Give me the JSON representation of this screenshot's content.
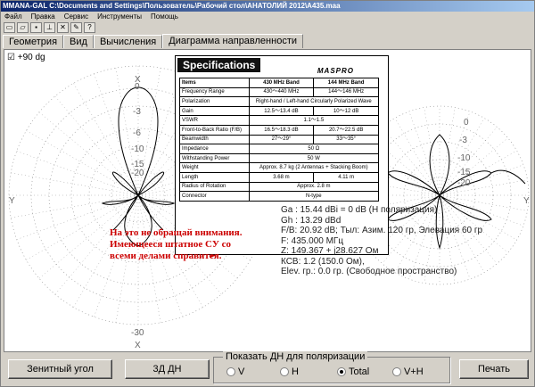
{
  "window": {
    "title": "MMANA-GAL C:\\Documents and Settings\\Пользователь\\Рабочий стол\\АНАТОЛИЙ 2012\\A435.maa"
  },
  "menu": [
    "Файл",
    "Правка",
    "Сервис",
    "Инструменты",
    "Помощь"
  ],
  "toolbar": [
    {
      "icon": "new-file-icon",
      "glyph": "▭"
    },
    {
      "icon": "open-folder-icon",
      "glyph": "▱"
    },
    {
      "icon": "save-icon",
      "glyph": "▪"
    },
    {
      "icon": "antenna-icon",
      "glyph": "⊥"
    },
    {
      "icon": "wrench-icon",
      "glyph": "✕"
    },
    {
      "icon": "pencil-icon",
      "glyph": "✎"
    },
    {
      "icon": "help-icon",
      "glyph": "?"
    }
  ],
  "tabs": [
    "Геометрия",
    "Вид",
    "Вычисления",
    "Диаграмма направленности"
  ],
  "active_tab": 3,
  "plot": {
    "checkbox_label": "+90 dg",
    "rings": [
      "0",
      "-3",
      "-6",
      "-10",
      "-15",
      "-20",
      "-30"
    ],
    "axes": {
      "top": "X",
      "left": "Y",
      "right": "Y",
      "bottom": "X"
    },
    "right_labels": [
      "0",
      "-3",
      "-10",
      "-15",
      "-20"
    ]
  },
  "specs": {
    "title": "Specifications",
    "brand": "MASPRO",
    "columns": [
      "Items",
      "430 MHz Band",
      "144 MHz Band"
    ],
    "rows": [
      [
        "Frequency Range",
        "430～440 MHz",
        "144～146 MHz"
      ],
      [
        "Polarization",
        "Right-hand / Left-hand Circularly Polarized Wave",
        ""
      ],
      [
        "Gain",
        "12.5～13.4 dB",
        "10～12 dB"
      ],
      [
        "VSWR",
        "1.1～1.5",
        ""
      ],
      [
        "Front-to-Back Ratio (F/B)",
        "16.5～18.3 dB",
        "20.7～22.5 dB"
      ],
      [
        "Beamwidth",
        "27～29°",
        "33～35°"
      ],
      [
        "Impedance",
        "50 Ω",
        ""
      ],
      [
        "Withstanding Power",
        "50 W",
        ""
      ],
      [
        "Weight",
        "Approx. 8.7 kg (2 Antennas + Stacking Boom)",
        ""
      ],
      [
        "Length",
        "3.68 m",
        "4.11 m"
      ],
      [
        "Radius of Rotation",
        "Approx. 2.8 m",
        ""
      ],
      [
        "Connector",
        "N-type",
        ""
      ]
    ]
  },
  "results": {
    "ga": "Ga : 15.44 dBi = 0 dB  (H поляризация)",
    "gh": "Gh : 13.29 dBd",
    "fb": "F/B: 20.92 dB; Тыл: Азим. 120 гр, Элевация 60 гр",
    "freq": "F: 435.000 МГц",
    "z": "Z: 149.367 + j28.627 Ом",
    "swr": "КСВ: 1.2 (150.0 Ом),",
    "elev": "Elev. гр.: 0.0 гр. (Свободное пространство)"
  },
  "annotation": "На это не обращай внимания. Имеющееся штатное СУ со всеми делами справится.",
  "bottom": {
    "zenith_button": "Зенитный угол",
    "view3d_button": "3Д  ДН",
    "group_label": "Показать ДН для поляризации",
    "radios": [
      "V",
      "H",
      "Total",
      "V+H"
    ],
    "selected_radio": "Total",
    "print_button": "Печать"
  },
  "colors": {
    "annotation": "#cc0000",
    "pattern": "#000000",
    "grid": "#808080"
  }
}
